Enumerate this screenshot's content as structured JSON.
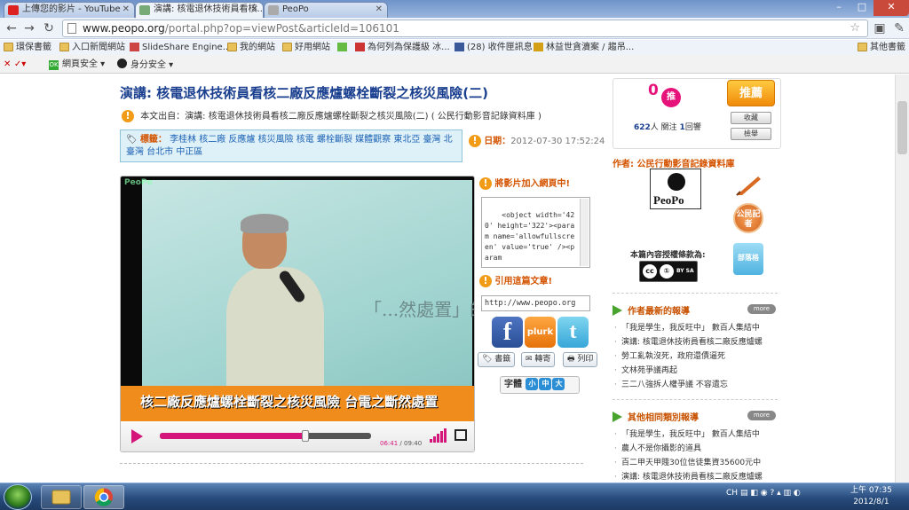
{
  "browser": {
    "tabs": [
      {
        "title": "上傳您的影片 - YouTube",
        "active": false
      },
      {
        "title": "演講: 核電退休技術員看核...",
        "active": true
      },
      {
        "title": "PeoPo",
        "active": false
      }
    ],
    "url_host": "www.peopo.org",
    "url_path": "/portal.php?op=viewPost&articleId=106101",
    "bookmarks": [
      "環保書籤",
      "入口新聞網站",
      "SlideShare Engine...",
      "我的網站",
      "好用網站",
      "為何列為保護級 冰...",
      "(28) 收件匣訊息",
      "林益世貪瀆案 / 趨吊...",
      "其他書籤"
    ],
    "extensions": [
      "網頁安全",
      "身分安全"
    ]
  },
  "article": {
    "title": "演講: 核電退休技術員看核二廠反應爐螺栓斷裂之核災風險(二)",
    "source_label": "本文出自：",
    "source_text": "演講: 核電退休技術員看核二廠反應爐螺栓斷裂之核災風險(二) ( 公民行動影音記錄資料庫 )",
    "tags_label": "標籤：",
    "tags": "李桂林  核二廠  反應爐  核災風險  核電  螺栓斷裂  媒體觀察  東北亞  臺灣  北臺灣  台北市  中正區",
    "date_label": "日期：",
    "date_value": "2012-07-30 17:52:24"
  },
  "video": {
    "watermark": "PeoPo",
    "scene_text": "「...然處置」的笑話",
    "caption": "核二廠反應爐螺栓斷裂之核災風險  台電之斷然處置",
    "current_time": "06:41",
    "duration": "09:40",
    "progress": 0.69
  },
  "share": {
    "embed_label": "將影片加入網頁中!",
    "embed_code": "<object width='420' height='322'><param name='allowfullscreen' value='true' /><param",
    "cite_label": "引用這篇文章!",
    "cite_url": "http://www.peopo.org",
    "facebook": "f",
    "plurk": "plurk",
    "twitter": "t",
    "bookmark_btn": "書籤",
    "forward_btn": "轉寄",
    "print_btn": "列印",
    "font_label": "字體",
    "font_sizes": [
      "小",
      "中",
      "大"
    ]
  },
  "sidebar": {
    "vote_count": "0",
    "vote_label": "推",
    "recommend_label": "推薦",
    "views": "622",
    "views_unit": "人 關注",
    "replies": "1",
    "replies_unit": "回響",
    "collect_btn": "收藏",
    "report_btn": "檢舉",
    "author_label": "作者: 公民行動影音記錄資料庫",
    "logo_text": "PeoPo",
    "citizen_badge": "公民記者",
    "blog_badge": "部落格",
    "license_label": "本篇內容授權條款為:",
    "cc_label": "BY SA",
    "author_news_title": "作者最新的報導",
    "author_news": [
      "「我是學生，我反旺中」 數百人集結中",
      "演講: 核電退休技術員看核二廠反應爐螺",
      "勞工亂執沒死，政府還債逼死",
      "文林苑爭議再起",
      "三二八強拆人權爭議 不容遺忘"
    ],
    "related_title": "其他相同類別報導",
    "related_news": [
      "「我是學生，我反旺中」 數百人集結中",
      "農人不是你攝影的道具",
      "百二甲天甲賤30位信徒集資35600元中",
      "演講: 核電退休技術員看核二廠反應爐螺"
    ],
    "more_label": "more"
  },
  "taskbar": {
    "lang": "CH",
    "time": "上午 07:35",
    "date": "2012/8/1"
  },
  "colors": {
    "title_blue": "#1a3f8f",
    "accent_orange": "#d45400",
    "video_pink": "#d4157a",
    "caption_orange": "#f08c1c"
  }
}
